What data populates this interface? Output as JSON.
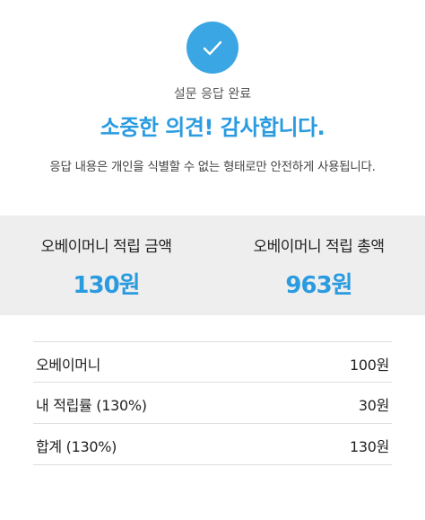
{
  "completion": {
    "icon": "check-icon",
    "icon_color": "#3aa6e3",
    "subtitle": "설문 응답 완료",
    "headline": "소중한 의견! 감사합니다.",
    "description": "응답 내용은 개인을 식별할 수 없는 형태로만 안전하게 사용됩니다.",
    "accent_color": "#2b9be0"
  },
  "summary": {
    "earned_label": "오베이머니 적립 금액",
    "earned_value": "130원",
    "total_label": "오베이머니 적립 총액",
    "total_value": "963원"
  },
  "details": {
    "rows": [
      {
        "label": "오베이머니",
        "value": "100원"
      },
      {
        "label": "내 적립률 (130%)",
        "value": "30원"
      },
      {
        "label": "합계 (130%)",
        "value": "130원"
      }
    ]
  }
}
